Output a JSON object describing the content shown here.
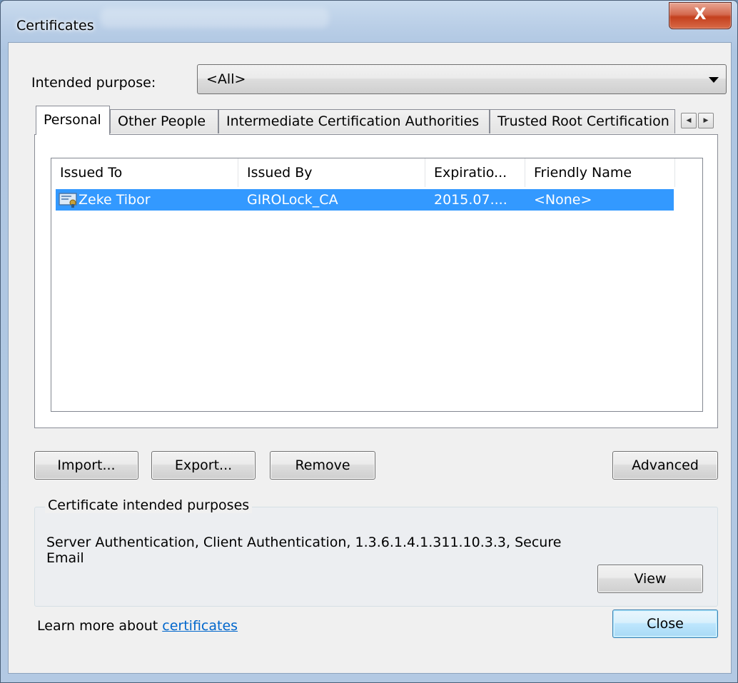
{
  "window": {
    "title": "Certificates",
    "close_glyph": "X"
  },
  "purpose": {
    "label": "Intended purpose:",
    "selected": "<All>"
  },
  "tabs": [
    {
      "label": "Personal",
      "active": true
    },
    {
      "label": "Other People",
      "active": false
    },
    {
      "label": "Intermediate Certification Authorities",
      "active": false
    },
    {
      "label": "Trusted Root Certification",
      "active": false
    }
  ],
  "tab_scroll": {
    "left": "◀",
    "right": "▶"
  },
  "list": {
    "columns": [
      "Issued To",
      "Issued By",
      "Expiratio...",
      "Friendly Name"
    ],
    "rows": [
      {
        "issued_to": "Zeke Tibor",
        "issued_by": "GIROLock_CA",
        "expiration": "2015.07....",
        "friendly_name": "<None>",
        "selected": true,
        "icon": "certificate-icon"
      }
    ]
  },
  "buttons": {
    "import": "Import...",
    "export": "Export...",
    "remove": "Remove",
    "advanced": "Advanced",
    "view": "View",
    "close": "Close"
  },
  "purposes_group": {
    "legend": "Certificate intended purposes",
    "text": "Server Authentication, Client Authentication, 1.3.6.1.4.1.311.10.3.3, Secure Email"
  },
  "footer": {
    "learn_prefix": "Learn more about ",
    "learn_link": "certificates"
  },
  "colors": {
    "selection": "#3399ff",
    "link": "#0066cc",
    "close_button": "#c4401e"
  }
}
